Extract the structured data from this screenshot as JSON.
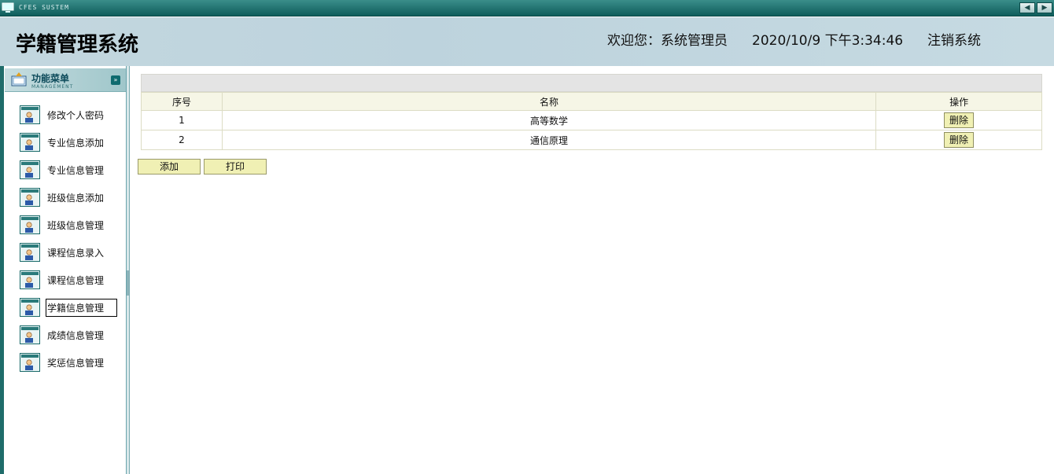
{
  "window": {
    "system_label": "CFES SUSTEM",
    "nav_prev": "◀",
    "nav_next": "▶"
  },
  "header": {
    "title": "学籍管理系统",
    "welcome": "欢迎您：系统管理员",
    "datetime": "2020/10/9 下午3:34:46",
    "logout": "注销系统"
  },
  "sidebar": {
    "menu_title": "功能菜单",
    "menu_subtitle": "MANAGEMENT",
    "toggle": "»",
    "items": [
      {
        "label": "修改个人密码"
      },
      {
        "label": "专业信息添加"
      },
      {
        "label": "专业信息管理"
      },
      {
        "label": "班级信息添加"
      },
      {
        "label": "班级信息管理"
      },
      {
        "label": "课程信息录入"
      },
      {
        "label": "课程信息管理"
      },
      {
        "label": "学籍信息管理",
        "active": true
      },
      {
        "label": "成绩信息管理"
      },
      {
        "label": "奖惩信息管理"
      }
    ]
  },
  "table": {
    "headers": [
      "序号",
      "名称",
      "操作"
    ],
    "rows": [
      {
        "index": "1",
        "name": "高等数学",
        "action": "删除"
      },
      {
        "index": "2",
        "name": "通信原理",
        "action": "删除"
      }
    ]
  },
  "actions": {
    "add": "添加",
    "print": "打印"
  },
  "colors": {
    "teal": "#0f5d5b",
    "header_bg": "#c3d7df",
    "button_bg": "#f0f0b4"
  }
}
